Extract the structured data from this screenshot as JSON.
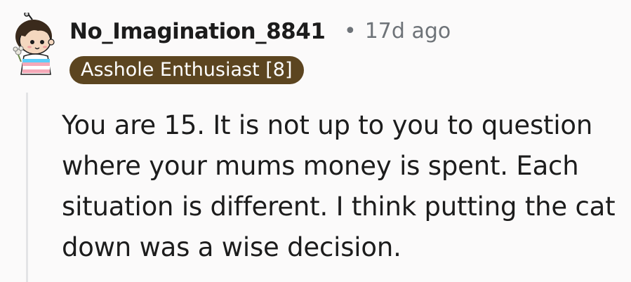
{
  "comment": {
    "author": "No_Imagination_8841",
    "separator": "•",
    "age": "17d ago",
    "flair": "Asshole Enthusiast [8]",
    "body": "You are 15. It is not up to you to question\nwhere your mums money is spent. Each\nsituation is different. I think putting the cat\ndown was a wise decision.",
    "avatar_icon": "snoo-avatar-icon",
    "flair_color": "#5c4520",
    "meta_color": "#6e7378"
  }
}
